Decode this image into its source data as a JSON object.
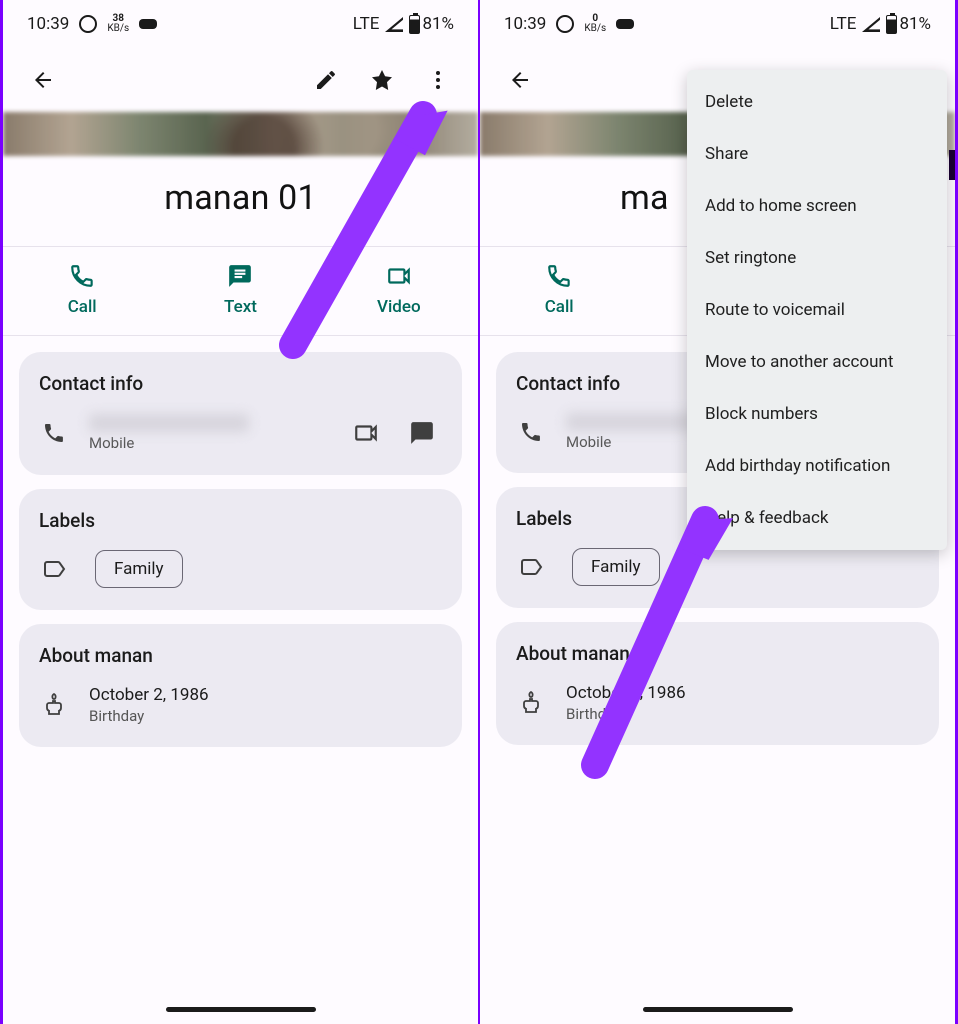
{
  "status": {
    "time": "10:39",
    "netRate": "38",
    "netRateUnit": "KB/s",
    "netRate2": "0",
    "signal": "LTE",
    "battery": "81%"
  },
  "contact": {
    "name": "manan 01",
    "actions": {
      "call": "Call",
      "text": "Text",
      "video": "Video"
    },
    "info": {
      "title": "Contact info",
      "phoneType": "Mobile"
    },
    "labels": {
      "title": "Labels",
      "family": "Family"
    },
    "about": {
      "title": "About manan",
      "date": "October 2, 1986",
      "dateLabel": "Birthday"
    }
  },
  "menu": {
    "delete": "Delete",
    "share": "Share",
    "addHome": "Add to home screen",
    "ringtone": "Set ringtone",
    "voicemail": "Route to voicemail",
    "moveAcct": "Move to another account",
    "block": "Block numbers",
    "bday": "Add birthday notification",
    "help": "Help & feedback"
  }
}
